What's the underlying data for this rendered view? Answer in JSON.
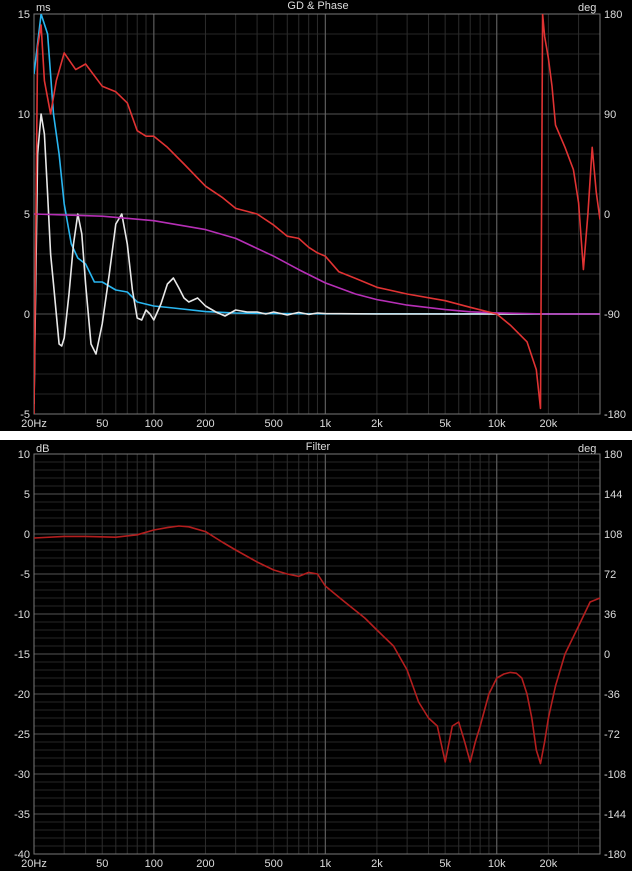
{
  "charts": [
    {
      "title": "GD & Phase",
      "left_unit": "ms",
      "right_unit": "deg",
      "left_ticks": [
        "15",
        "10",
        "5",
        "0",
        "-5"
      ],
      "left_values": [
        15,
        10,
        5,
        0,
        -5
      ],
      "right_ticks": [
        "180",
        "90",
        "0",
        "-90",
        "-180"
      ],
      "x_ticks": [
        "20Hz",
        "50",
        "100",
        "200",
        "500",
        "1k",
        "2k",
        "5k",
        "10k",
        "20k"
      ]
    },
    {
      "title": "Filter",
      "left_unit": "dB",
      "right_unit": "deg",
      "left_ticks": [
        "10",
        "5",
        "0",
        "-5",
        "-10",
        "-15",
        "-20",
        "-25",
        "-30",
        "-35",
        "-40"
      ],
      "left_values": [
        10,
        5,
        0,
        -5,
        -10,
        -15,
        -20,
        -25,
        -30,
        -35,
        -40
      ],
      "right_ticks": [
        "180",
        "144",
        "108",
        "72",
        "36",
        "0",
        "-36",
        "-72",
        "-108",
        "-144",
        "-180"
      ],
      "x_ticks": [
        "20Hz",
        "50",
        "100",
        "200",
        "500",
        "1k",
        "2k",
        "5k",
        "10k",
        "20k"
      ]
    }
  ],
  "chart_data": [
    {
      "type": "line",
      "title": "GD & Phase",
      "xscale": "log",
      "xlim": [
        20,
        40000
      ],
      "ylim": [
        -5,
        15
      ],
      "y2lim": [
        -180,
        180
      ],
      "ylabel": "ms",
      "y2label": "deg",
      "grid": true,
      "series": [
        {
          "color": "#29b6f0",
          "axis": "left",
          "x": [
            20,
            22,
            24,
            26,
            28,
            30,
            33,
            36,
            40,
            45,
            50,
            60,
            70,
            80,
            100,
            130,
            200,
            300,
            500,
            1000,
            20000,
            40000
          ],
          "y": [
            12,
            15,
            14,
            10,
            8,
            5.5,
            3.5,
            2.8,
            2.5,
            1.6,
            1.6,
            1.2,
            1.1,
            0.6,
            0.4,
            0.3,
            0.12,
            0.05,
            0.02,
            0.01,
            0.0,
            0.0
          ]
        },
        {
          "color": "#e8e8e8",
          "axis": "left",
          "x": [
            20,
            21,
            22,
            23,
            24,
            25,
            26,
            27,
            28,
            29,
            30,
            32,
            34,
            36,
            38,
            40,
            43,
            46,
            50,
            55,
            60,
            65,
            70,
            75,
            80,
            85,
            90,
            95,
            100,
            110,
            120,
            130,
            140,
            150,
            160,
            180,
            200,
            230,
            260,
            300,
            350,
            400,
            450,
            500,
            600,
            700,
            800,
            900,
            1000,
            1500,
            2000,
            5000,
            20000,
            40000
          ],
          "y": [
            -4.5,
            8,
            10,
            9,
            6,
            3,
            1.5,
            0,
            -1.5,
            -1.6,
            -1.2,
            1,
            3.5,
            5,
            4,
            1.5,
            -1.5,
            -2,
            -0.5,
            2,
            4.5,
            5,
            3.5,
            1.2,
            -0.2,
            -0.3,
            0.2,
            0,
            -0.3,
            0.5,
            1.5,
            1.8,
            1.3,
            0.8,
            0.6,
            0.8,
            0.4,
            0.1,
            -0.1,
            0.2,
            0.1,
            0.1,
            0.0,
            0.1,
            -0.05,
            0.08,
            -0.02,
            0.05,
            0.02,
            0.01,
            0.0,
            0.0,
            0.0,
            0.0
          ]
        },
        {
          "color": "#b62fb6",
          "axis": "right",
          "x": [
            20,
            50,
            100,
            200,
            300,
            500,
            700,
            1000,
            1500,
            2000,
            3000,
            5000,
            7000,
            10000,
            20000,
            40000
          ],
          "y": [
            0,
            -2,
            -6,
            -14,
            -22,
            -38,
            -50,
            -62,
            -72,
            -77,
            -82,
            -86,
            -88,
            -89,
            -90,
            -90
          ]
        },
        {
          "color": "#e03333",
          "axis": "right",
          "x": [
            20,
            21,
            22,
            23,
            25,
            27,
            30,
            35,
            40,
            50,
            60,
            70,
            80,
            90,
            100,
            120,
            150,
            200,
            250,
            300,
            400,
            500,
            600,
            700,
            800,
            900,
            1000,
            1200,
            1500,
            2000,
            3000,
            5000,
            7000,
            10000,
            12000,
            15000,
            17000,
            18000,
            18500,
            19000,
            19500,
            20000,
            21000,
            22000,
            25000,
            28000,
            30000,
            32000,
            34000,
            36000,
            38000,
            40000
          ],
          "y": [
            -180,
            150,
            170,
            120,
            90,
            120,
            145,
            130,
            135,
            115,
            110,
            100,
            75,
            70,
            70,
            60,
            45,
            25,
            15,
            5,
            0,
            -10,
            -20,
            -22,
            -30,
            -35,
            -38,
            -52,
            -58,
            -66,
            -72,
            -78,
            -84,
            -90,
            -100,
            -115,
            -140,
            -175,
            180,
            160,
            150,
            140,
            115,
            80,
            60,
            40,
            10,
            -50,
            0,
            60,
            20,
            -5
          ]
        }
      ]
    },
    {
      "type": "line",
      "title": "Filter",
      "xscale": "log",
      "xlim": [
        20,
        40000
      ],
      "ylim": [
        -40,
        10
      ],
      "y2lim": [
        -180,
        180
      ],
      "ylabel": "dB",
      "y2label": "deg",
      "grid": true,
      "series": [
        {
          "color": "#b31e1e",
          "axis": "left",
          "x": [
            20,
            30,
            40,
            60,
            80,
            100,
            120,
            140,
            160,
            200,
            250,
            300,
            400,
            500,
            600,
            700,
            800,
            900,
            1000,
            1300,
            1700,
            2000,
            2500,
            3000,
            3500,
            4000,
            4500,
            5000,
            5500,
            6000,
            6500,
            7000,
            7500,
            8000,
            9000,
            10000,
            11000,
            12000,
            13000,
            14000,
            15000,
            16000,
            17000,
            18000,
            19000,
            20000,
            22000,
            25000,
            30000,
            35000,
            40000
          ],
          "y": [
            -0.5,
            -0.3,
            -0.3,
            -0.4,
            -0.1,
            0.5,
            0.8,
            1.0,
            0.9,
            0.3,
            -1.0,
            -2.0,
            -3.5,
            -4.5,
            -5,
            -5.3,
            -4.8,
            -5,
            -6.5,
            -8.5,
            -10.5,
            -12,
            -14,
            -17,
            -21,
            -23,
            -24,
            -28.5,
            -24,
            -23.5,
            -26,
            -28.5,
            -26,
            -24,
            -20,
            -18,
            -17.5,
            -17.3,
            -17.4,
            -18,
            -20,
            -23,
            -27,
            -28.7,
            -26,
            -23,
            -19,
            -15,
            -11.5,
            -8.5,
            -8
          ]
        }
      ]
    }
  ]
}
